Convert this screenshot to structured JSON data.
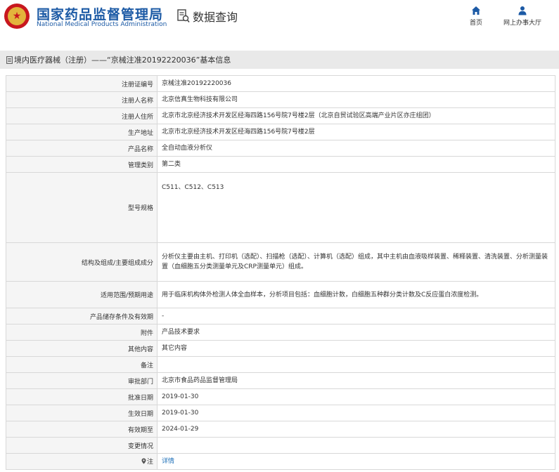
{
  "header": {
    "brand_cn": "国家药品监督管理局",
    "brand_en": "National Medical Products Administration",
    "query_label": "数据查询",
    "nav": {
      "home": "首页",
      "public_service": "网上办事大厅"
    },
    "colors": {
      "brand": "#1c5aa5",
      "logo_red": "#c8171e"
    }
  },
  "title": "境内医疗器械（注册）——“京械注准20192220036”基本信息",
  "rows": [
    {
      "key": "注册证编号",
      "value": "京械注准20192220036"
    },
    {
      "key": "注册人名称",
      "value": "北京信真生物科技有限公司"
    },
    {
      "key": "注册人住所",
      "value": "北京市北京经济技术开发区经海四路156号院7号楼2层（北京自贸试验区高端产业片区亦庄组团）"
    },
    {
      "key": "生产地址",
      "value": "北京市北京经济技术开发区经海四路156号院7号楼2层"
    },
    {
      "key": "产品名称",
      "value": "全自动血液分析仪"
    },
    {
      "key": "管理类别",
      "value": "第二类"
    },
    {
      "key": "型号规格",
      "value": "C511、C512、C513"
    },
    {
      "key": "结构及组成/主要组成成分",
      "value": "分析仪主要由主机、打印机（选配）、扫描枪（选配）、计算机（选配）组成，其中主机由血液吸样装置、稀释装置、清洗装置、分析测量装置（血细胞五分类测量单元及CRP测量单元）组成。"
    },
    {
      "key": "适用范围/预期用途",
      "value": "用于临床机构体外检测人体全血样本，分析项目包括：血细胞计数，白细胞五种群分类计数及C反应蛋白浓度检测。"
    },
    {
      "key": "产品储存条件及有效期",
      "value": "-"
    },
    {
      "key": "附件",
      "value": "产品技术要求"
    },
    {
      "key": "其他内容",
      "value": "其它内容"
    },
    {
      "key": "备注",
      "value": ""
    },
    {
      "key": "审批部门",
      "value": "北京市食品药品监督管理局"
    },
    {
      "key": "批准日期",
      "value": "2019-01-30"
    },
    {
      "key": "生效日期",
      "value": "2019-01-30"
    },
    {
      "key": "有效期至",
      "value": "2024-01-29"
    },
    {
      "key": "变更情况",
      "value": ""
    },
    {
      "key": "注",
      "value": "详情"
    }
  ]
}
